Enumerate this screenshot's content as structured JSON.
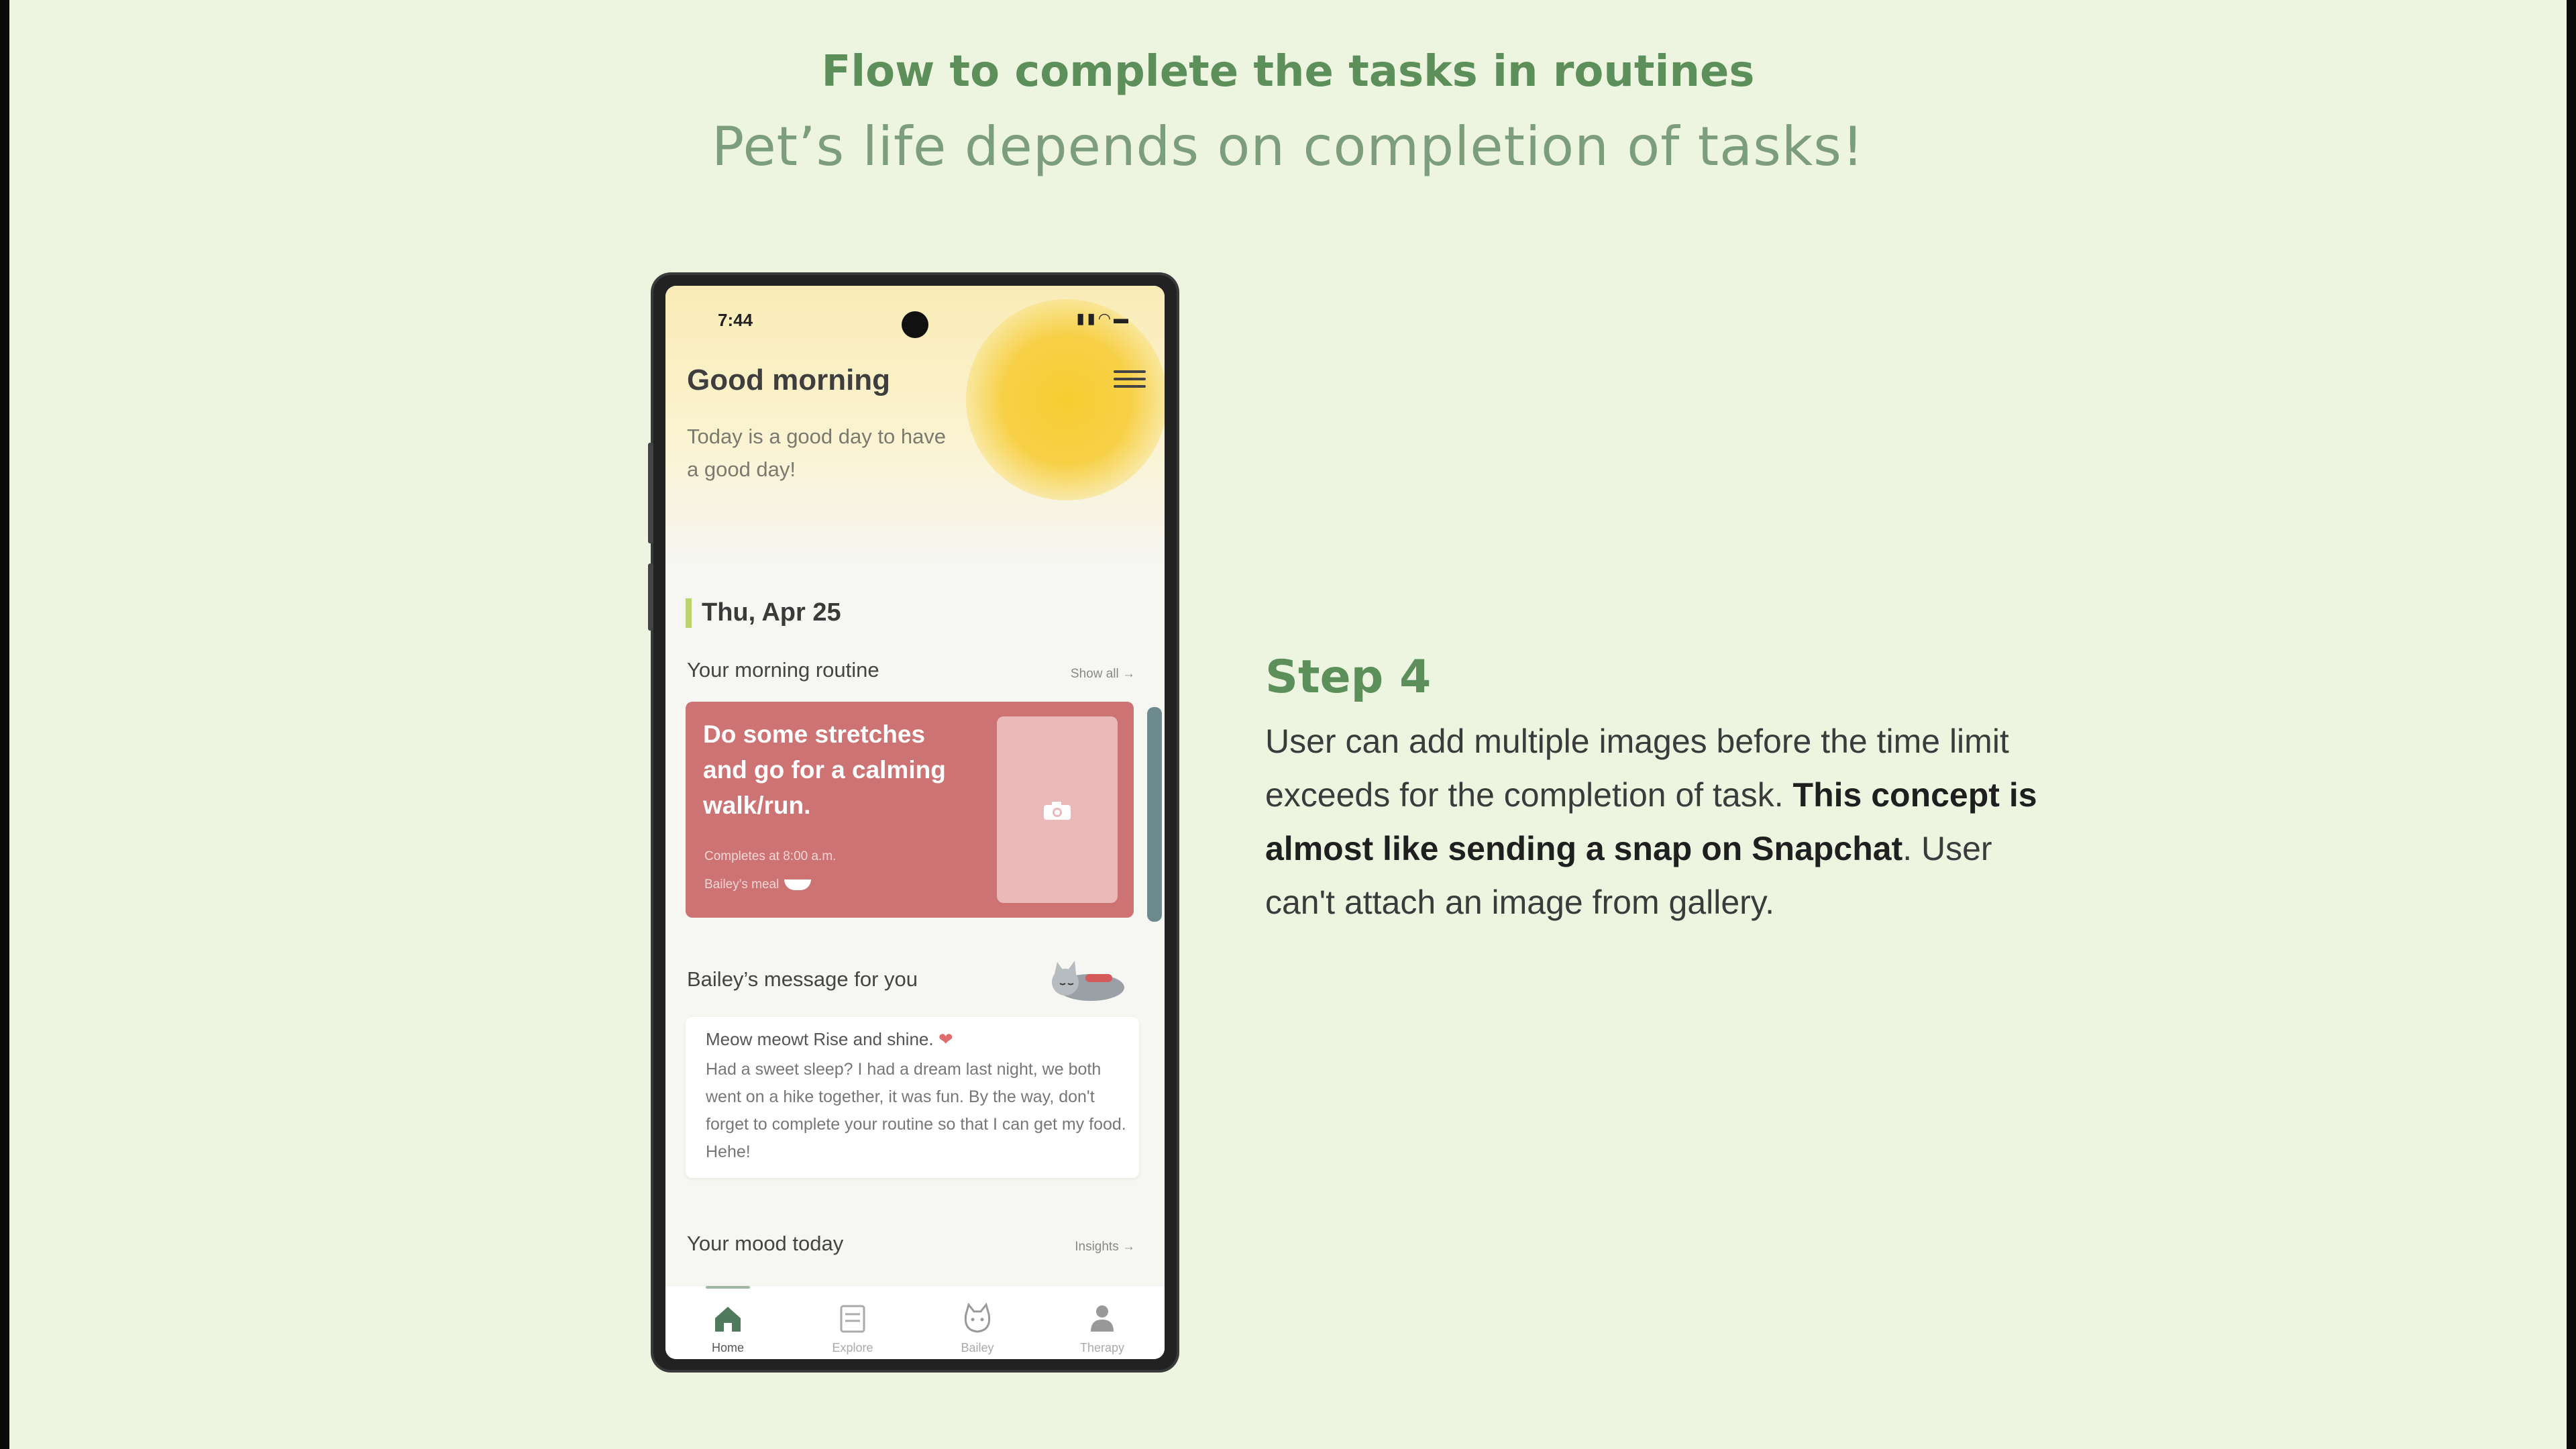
{
  "slide": {
    "title": "Flow to complete the tasks in routines",
    "subtitle": "Pet’s life depends on completion of tasks!"
  },
  "phone": {
    "status_time": "7:44",
    "greeting": "Good morning",
    "tagline": "Today is a good day to have a good day!",
    "date": "Thu, Apr 25",
    "routine": {
      "title": "Your morning routine",
      "show_all": "Show all →",
      "task": {
        "text": "Do some stretches and go for a calming walk/run.",
        "completes": "Completes at 8:00 a.m.",
        "meal": "Bailey's meal"
      }
    },
    "message": {
      "title": "Bailey’s message for you",
      "first_line": "Meow meowt Rise and shine.",
      "body": "Had a sweet sleep? I had a dream last night, we both went on a hike together, it was fun. By the way, don't forget to complete your routine so that I can get my food. Hehe!"
    },
    "mood": {
      "title": "Your mood today",
      "insights": "Insights →"
    },
    "nav": [
      {
        "label": "Home",
        "icon": "home-icon",
        "active": true
      },
      {
        "label": "Explore",
        "icon": "explore-icon",
        "active": false
      },
      {
        "label": "Bailey",
        "icon": "cat-face-icon",
        "active": false
      },
      {
        "label": "Therapy",
        "icon": "person-icon",
        "active": false
      }
    ]
  },
  "step": {
    "title": "Step 4",
    "body_1": "User can add multiple images before the time limit exceeds for the completion of task.",
    "body_bold": "This concept is almost like sending a snap on Snapchat",
    "body_2": ". User can't attach an image from gallery."
  },
  "colors": {
    "background": "#edf5e1",
    "heading_green": "#5c8f5a",
    "task_card": "#cd7374",
    "sun": "#f7cd31",
    "date_accent": "#b8d46b"
  }
}
